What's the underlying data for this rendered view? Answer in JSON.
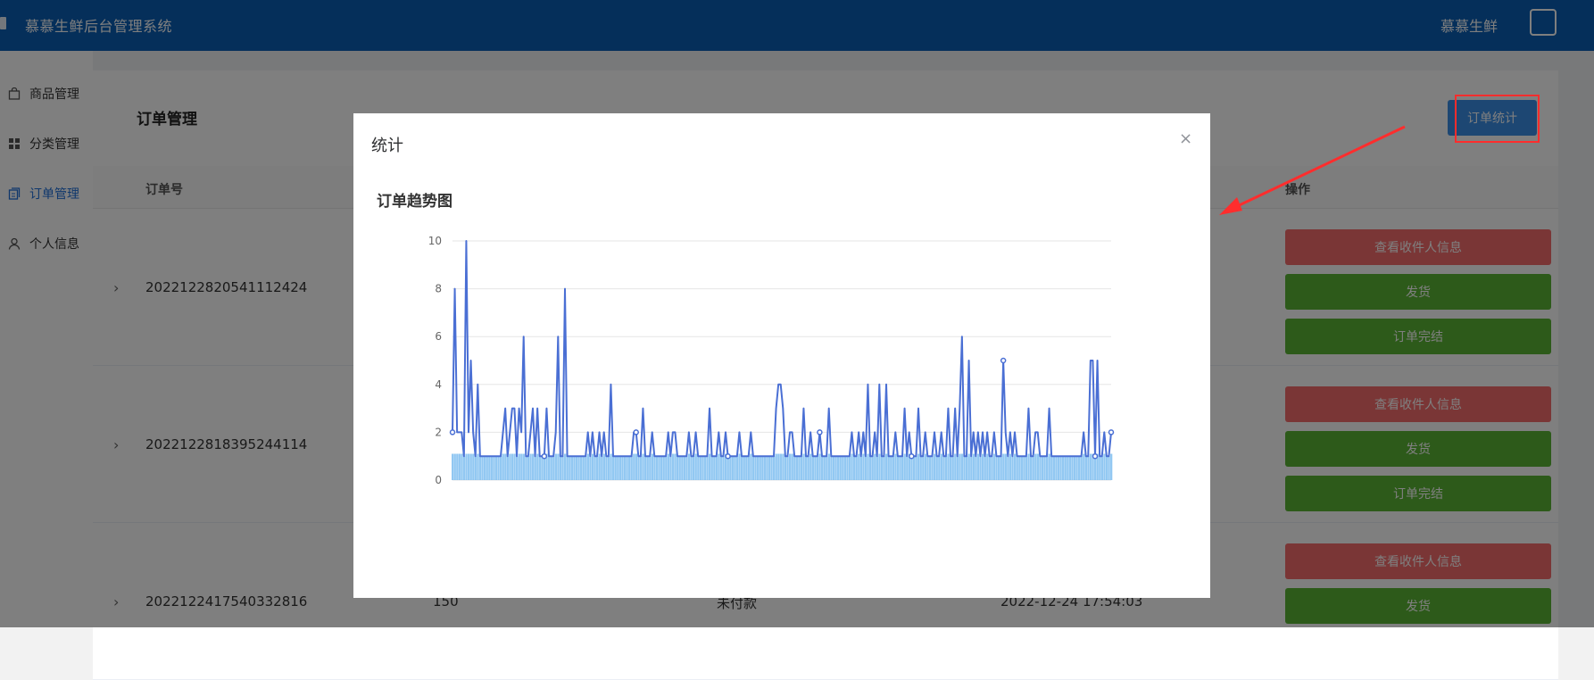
{
  "app": {
    "title": "慕慕生鲜后台管理系统",
    "user_name": "慕慕生鲜"
  },
  "sidebar": {
    "items": [
      {
        "label": "商品管理",
        "icon": "bag-icon",
        "active": false
      },
      {
        "label": "分类管理",
        "icon": "grid-icon",
        "active": false
      },
      {
        "label": "订单管理",
        "icon": "order-icon",
        "active": true
      },
      {
        "label": "个人信息",
        "icon": "user-icon",
        "active": false
      }
    ]
  },
  "page": {
    "title": "订单管理",
    "stats_button": "订单统计",
    "columns": {
      "order_no": "订单号",
      "actions": "操作"
    },
    "rows": [
      {
        "order_no": "2022122820541112424",
        "amount": "",
        "status": "",
        "time": ""
      },
      {
        "order_no": "2022122818395244114",
        "amount": "",
        "status": "",
        "time": ""
      },
      {
        "order_no": "2022122417540332816",
        "amount": "150",
        "status": "未付款",
        "time": "2022-12-24 17:54:03"
      }
    ],
    "actions": {
      "view_receiver": "查看收件人信息",
      "ship": "发货",
      "complete": "订单完结"
    }
  },
  "modal": {
    "title": "统计",
    "close_icon": "close-icon",
    "chart_title": "订单趋势图"
  },
  "colors": {
    "topbar": "#0b5eb5",
    "line": "#4a6fd4",
    "bars": "#7fbef0",
    "danger": "#f56c6c",
    "success": "#5ab534",
    "annotation": "#ff2d2d"
  },
  "chart_data": {
    "type": "line",
    "title": "订单趋势图",
    "xlabel": "",
    "ylabel": "",
    "ylim": [
      0,
      10
    ],
    "yticks": [
      0,
      2,
      4,
      6,
      8,
      10
    ],
    "grid": true,
    "series": [
      {
        "values": [
          2,
          8,
          2,
          2,
          2,
          1,
          10,
          2,
          5,
          2,
          1,
          4,
          1,
          1,
          1,
          1,
          1,
          1,
          1,
          1,
          1,
          1,
          2,
          3,
          1,
          2,
          3,
          3,
          1,
          3,
          2,
          6,
          1,
          1,
          2,
          3,
          1,
          3,
          1,
          1,
          1,
          3,
          1,
          1,
          1,
          2,
          6,
          1,
          1,
          8,
          1,
          1,
          1,
          1,
          1,
          1,
          1,
          1,
          1,
          2,
          1,
          2,
          1,
          1,
          2,
          1,
          2,
          1,
          1,
          4,
          1,
          1,
          1,
          1,
          1,
          1,
          1,
          1,
          1,
          2,
          2,
          1,
          1,
          3,
          1,
          1,
          1,
          2,
          1,
          1,
          1,
          1,
          1,
          1,
          2,
          1,
          2,
          2,
          1,
          1,
          1,
          1,
          1,
          2,
          1,
          1,
          2,
          1,
          1,
          1,
          1,
          1,
          3,
          1,
          1,
          1,
          2,
          1,
          1,
          2,
          1,
          1,
          1,
          1,
          1,
          2,
          1,
          1,
          1,
          1,
          2,
          1,
          1,
          1,
          1,
          1,
          1,
          1,
          1,
          1,
          1,
          3,
          4,
          4,
          3,
          1,
          1,
          2,
          2,
          1,
          1,
          1,
          1,
          3,
          1,
          1,
          2,
          1,
          1,
          1,
          2,
          1,
          1,
          1,
          3,
          1,
          1,
          1,
          1,
          1,
          1,
          1,
          1,
          1,
          2,
          1,
          1,
          2,
          1,
          2,
          1,
          4,
          1,
          1,
          2,
          1,
          4,
          1,
          1,
          4,
          1,
          1,
          1,
          2,
          1,
          1,
          1,
          3,
          1,
          2,
          1,
          1,
          1,
          3,
          1,
          1,
          2,
          1,
          1,
          1,
          2,
          1,
          1,
          2,
          1,
          1,
          3,
          1,
          1,
          3,
          1,
          3,
          6,
          1,
          1,
          5,
          1,
          2,
          1,
          2,
          1,
          2,
          1,
          2,
          1,
          1,
          2,
          1,
          1,
          1,
          5,
          2,
          1,
          2,
          1,
          2,
          1,
          1,
          1,
          1,
          1,
          3,
          1,
          1,
          2,
          2,
          1,
          1,
          1,
          1,
          3,
          1,
          1,
          1,
          1,
          1,
          1,
          1,
          1,
          1,
          1,
          1,
          1,
          1,
          1,
          2,
          1,
          1,
          5,
          5,
          1,
          5,
          1,
          1,
          2,
          1,
          1,
          2
        ]
      }
    ]
  }
}
